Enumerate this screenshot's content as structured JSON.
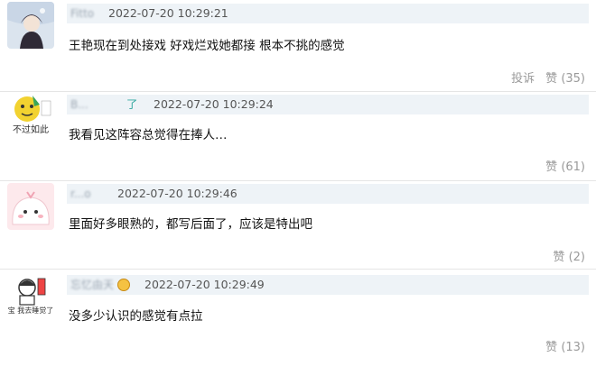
{
  "comments": [
    {
      "username": "Fitto",
      "time": "2022-07-20 10:29:21",
      "text": "王艳现在到处接戏 好戏烂戏她都接 根本不挑的感觉",
      "report_label": "投诉",
      "like_label": "赞",
      "like_count": "(35)"
    },
    {
      "username": "B...",
      "username_suffix": "了",
      "avatar_text": "不过如此",
      "time": "2022-07-20 10:29:24",
      "text": "我看见这阵容总觉得在捧人…",
      "like_label": "赞",
      "like_count": "(61)"
    },
    {
      "username": "r...o",
      "time": "2022-07-20 10:29:46",
      "text": "里面好多眼熟的，都写后面了，应该是特出吧",
      "like_label": "赞",
      "like_count": "(2)"
    },
    {
      "username": "忘忆由天",
      "avatar_text": "宝 我去睡觉了",
      "time": "2022-07-20 10:29:49",
      "text": "没多少认识的感觉有点拉",
      "like_label": "赞",
      "like_count": "(13)"
    }
  ]
}
